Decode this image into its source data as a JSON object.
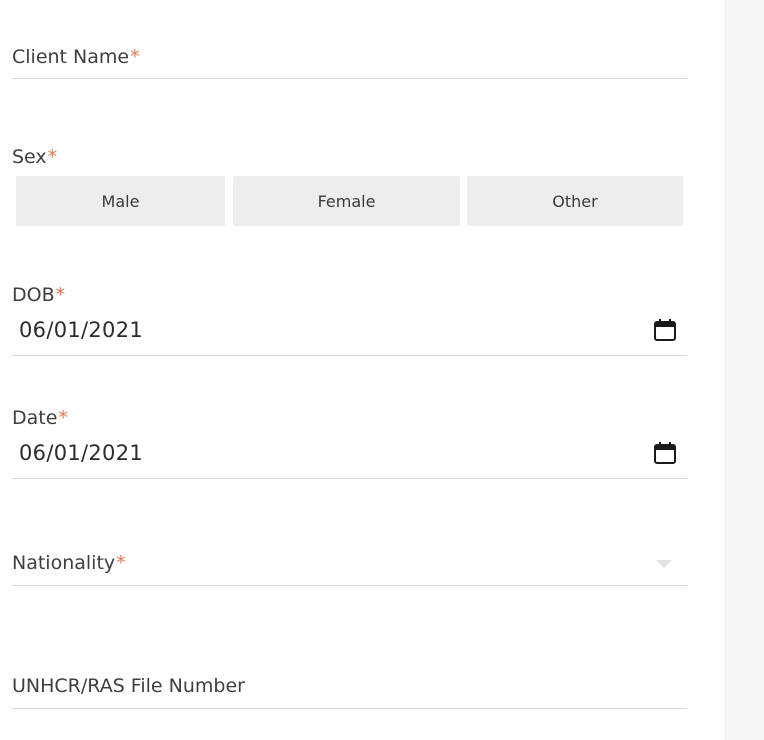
{
  "form": {
    "client_name": {
      "label": "Client Name",
      "required_mark": "*"
    },
    "sex": {
      "label": "Sex",
      "required_mark": "*",
      "options": [
        "Male",
        "Female",
        "Other"
      ]
    },
    "dob": {
      "label": "DOB",
      "required_mark": "*",
      "value": "06/01/2021"
    },
    "date": {
      "label": "Date",
      "required_mark": "*",
      "value": "06/01/2021"
    },
    "nationality": {
      "label": "Nationality",
      "required_mark": "*"
    },
    "file_number": {
      "label": "UNHCR/RAS File Number"
    }
  },
  "colors": {
    "required": "#e07a50",
    "button_bg": "#ededed",
    "underline": "#d6d6d6",
    "side_panel": "#f5f5f5"
  },
  "icons": {
    "dob_picker": "calendar-icon",
    "date_picker": "calendar-icon",
    "nationality_toggle": "caret-down-icon"
  }
}
